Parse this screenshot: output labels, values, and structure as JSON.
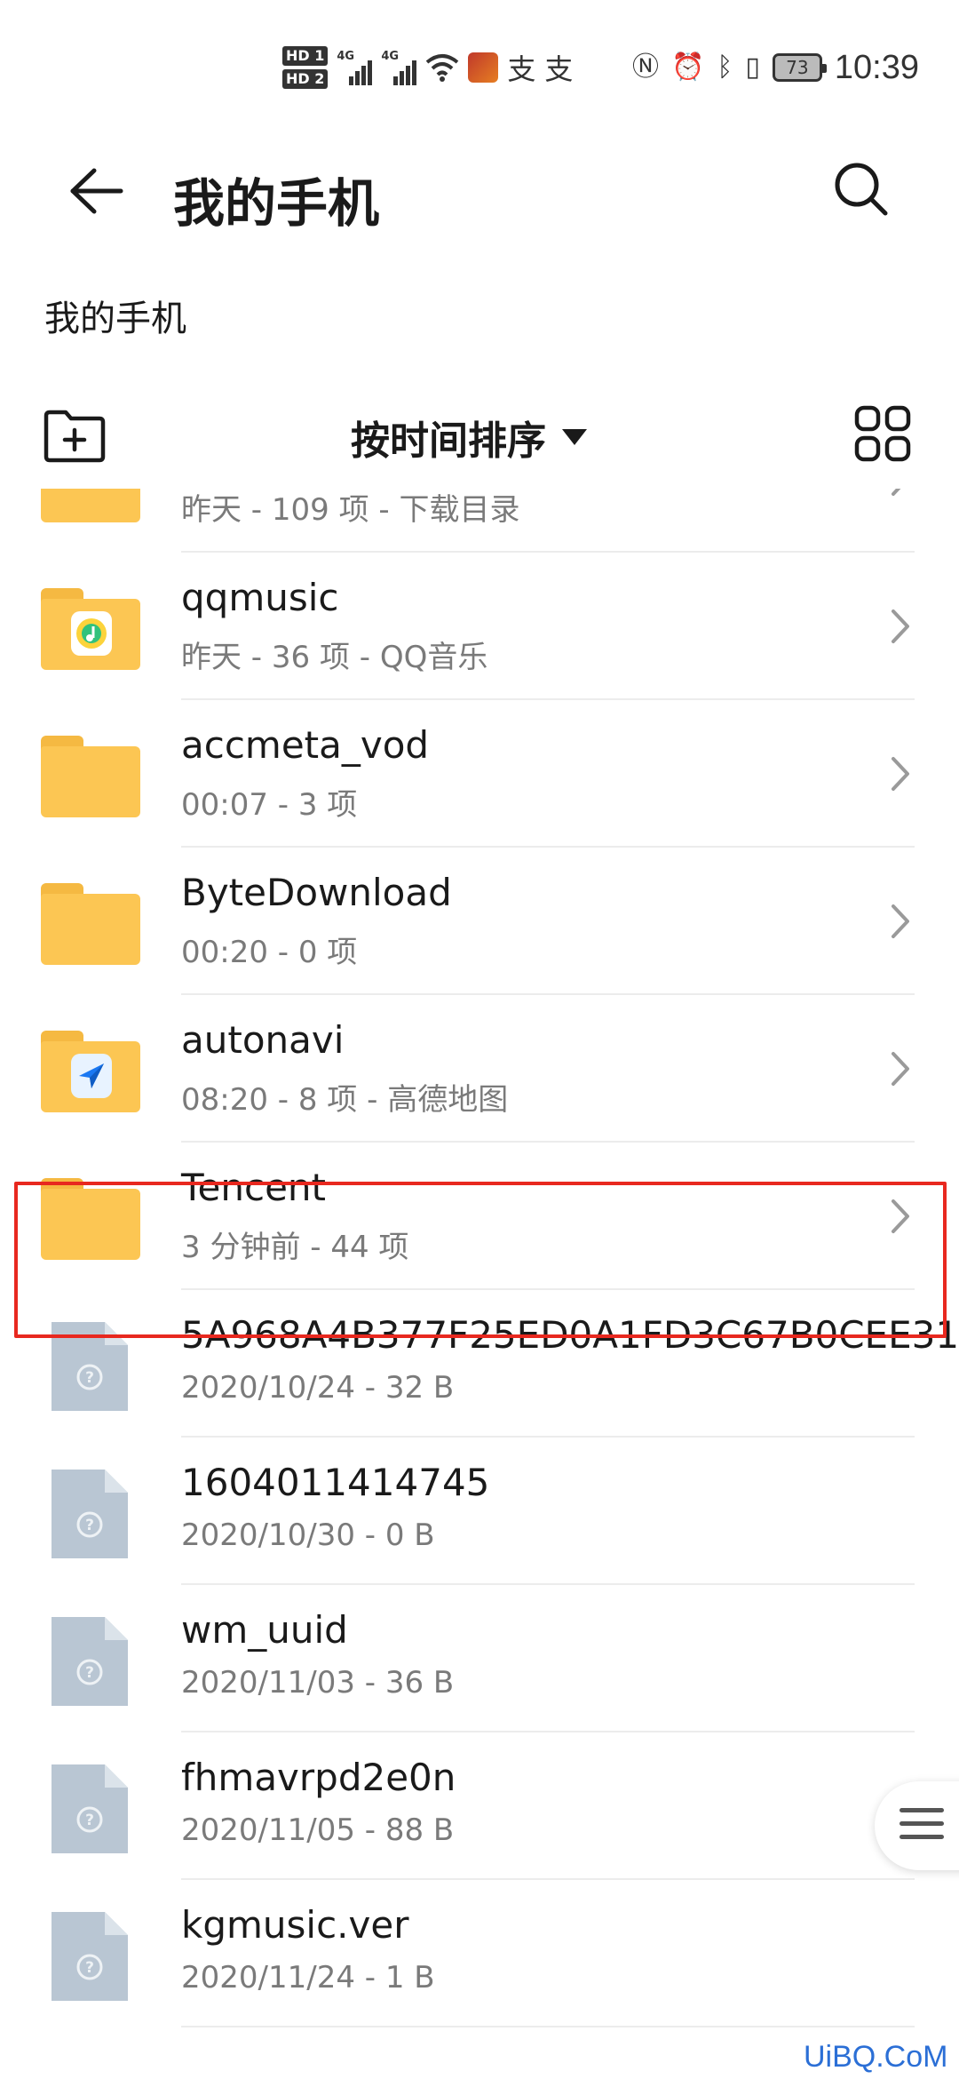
{
  "status_bar": {
    "hd1": "HD 1",
    "hd2": "HD 2",
    "sig1_label": "4G",
    "sig2_label": "4G",
    "carrier_chars": [
      "支",
      "支"
    ],
    "battery": "73",
    "time": "10:39"
  },
  "app_bar": {
    "title": "我的手机",
    "back_icon": "back-arrow-icon",
    "search_icon": "search-icon"
  },
  "breadcrumb": "我的手机",
  "toolbar": {
    "new_folder_icon": "new-folder-icon",
    "sort_label": "按时间排序",
    "view_icon": "grid-view-icon"
  },
  "items": [
    {
      "type": "folder",
      "name": "",
      "meta": "昨天 - 109 项 - 下载目录",
      "badge": "none",
      "chevron": true
    },
    {
      "type": "folder",
      "name": "qqmusic",
      "meta": "昨天 - 36 项 - QQ音乐",
      "badge": "qqmusic",
      "chevron": true
    },
    {
      "type": "folder",
      "name": "accmeta_vod",
      "meta": "00:07 - 3 项",
      "badge": "none",
      "chevron": true
    },
    {
      "type": "folder",
      "name": "ByteDownload",
      "meta": "00:20 - 0 项",
      "badge": "none",
      "chevron": true
    },
    {
      "type": "folder",
      "name": "autonavi",
      "meta": "08:20 - 8 项 - 高德地图",
      "badge": "autonavi",
      "chevron": true
    },
    {
      "type": "folder",
      "name": "Tencent",
      "meta": "3 分钟前 - 44 项",
      "badge": "none",
      "chevron": true,
      "highlighted": true
    },
    {
      "type": "file",
      "name": "5A968A4B377F25ED0A1FD3C67B0CEE31",
      "meta": "2020/10/24 - 32 B",
      "chevron": false
    },
    {
      "type": "file",
      "name": "1604011414745",
      "meta": "2020/10/30 - 0 B",
      "chevron": false
    },
    {
      "type": "file",
      "name": "wm_uuid",
      "meta": "2020/11/03 - 36 B",
      "chevron": false
    },
    {
      "type": "file",
      "name": "fhmavrpd2e0n",
      "meta": "2020/11/05 - 88 B",
      "chevron": false
    },
    {
      "type": "file",
      "name": "kgmusic.ver",
      "meta": "2020/11/24 - 1 B",
      "chevron": false
    }
  ],
  "colors": {
    "folder": "#fcc653",
    "folder_tab": "#f5b942",
    "file_icon": "#b9c6d3",
    "highlight": "#e8281f",
    "meta_text": "#7a7a7a"
  },
  "watermark": "UiBQ.CoM"
}
